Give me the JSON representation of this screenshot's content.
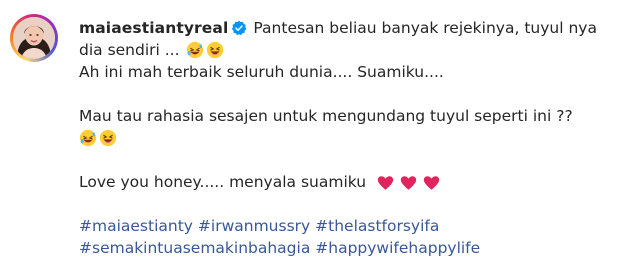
{
  "post": {
    "username": "maiaestiantyreal",
    "caption_line1": "Pantesan beliau banyak rejekinya, tuyul nya",
    "caption_line2": "dia sendiri ...",
    "caption_line3": "Ah ini mah terbaik seluruh dunia.... Suamiku....",
    "caption_line4": "Mau tau rahasia sesajen untuk mengundang tuyul seperti ini ??",
    "caption_line5": "Love you honey..... menyala suamiku",
    "hashtags_row1": [
      "#maiaestianty",
      "#irwanmussry",
      "#thelastforsyifa"
    ],
    "hashtags_row2": [
      "#semakintuasemakinbahagia",
      "#happywifehappylife"
    ]
  },
  "icons": {
    "verified": "verified-badge-icon",
    "emoji_laugh": "rolling-laughing-emoji",
    "emoji_grin": "grinning-squinting-emoji",
    "emoji_heart": "red-heart-emoji"
  },
  "colors": {
    "text": "#262626",
    "hashtag": "#385898",
    "verified": "#0095f6",
    "heart": "#e0245e"
  }
}
